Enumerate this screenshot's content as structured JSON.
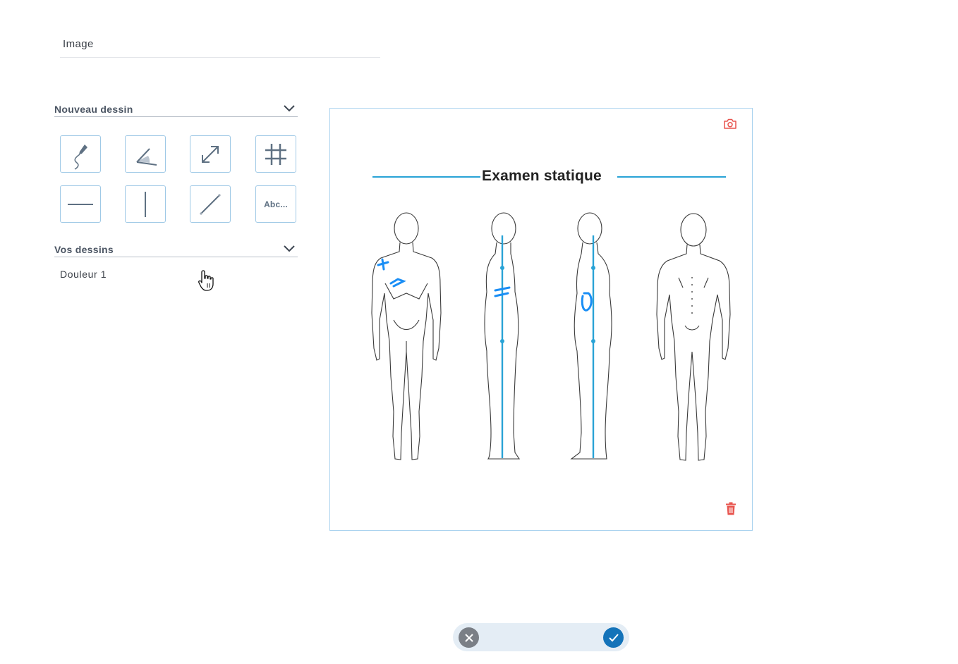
{
  "image_field": {
    "label": "Image"
  },
  "new_drawing": {
    "title": "Nouveau dessin",
    "tools": [
      {
        "name": "freehand-pen-tool",
        "icon": "pen-curve-icon"
      },
      {
        "name": "angle-tool",
        "icon": "angle-icon"
      },
      {
        "name": "distance-tool",
        "icon": "diagonal-arrows-icon"
      },
      {
        "name": "grid-tool",
        "icon": "hash-grid-icon"
      },
      {
        "name": "horizontal-line-tool",
        "icon": "horizontal-line-icon"
      },
      {
        "name": "vertical-line-tool",
        "icon": "vertical-line-icon"
      },
      {
        "name": "oblique-line-tool",
        "icon": "oblique-line-icon"
      },
      {
        "name": "text-tool",
        "icon": "text-icon",
        "label": "Abc..."
      }
    ]
  },
  "your_drawings": {
    "title": "Vos dessins",
    "items": [
      {
        "label": "Douleur 1"
      }
    ]
  },
  "canvas": {
    "image_title": "Examen statique",
    "camera_icon": "camera-icon",
    "delete_icon": "trash-icon",
    "accent_color": "#29a3d6",
    "annotation_color": "#1a8ef5",
    "danger_color": "#e8544e"
  },
  "actions": {
    "cancel_icon": "close-icon",
    "confirm_icon": "check-icon",
    "confirm_color": "#1473b9",
    "cancel_color": "#7a7f86"
  }
}
